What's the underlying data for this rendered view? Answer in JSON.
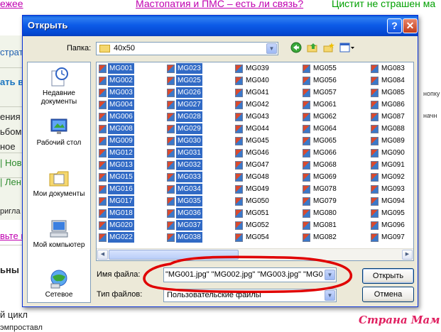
{
  "background_page": {
    "top_links": [
      "Мастопатия и ПМС – есть ли связь?",
      "Цистит не страшен ма"
    ],
    "left_texts": [
      "ежее",
      "страт",
      "ать в",
      "ения",
      "ьбом",
      "ное",
      "| Нов",
      "| Лен",
      "ригла",
      "вьте в",
      "ьны",
      "й цикл",
      "эмпроставл"
    ],
    "right_texts": [
      "нопку",
      "начн"
    ],
    "watermark": "Страна Мам"
  },
  "dialog": {
    "title": "Открыть",
    "help_button": "?",
    "close_button": "✕",
    "folder_label": "Папка:",
    "folder_value": "40x50",
    "toolbar_icons": [
      "back-icon",
      "up-folder-icon",
      "new-folder-icon",
      "view-menu-icon"
    ],
    "places": [
      {
        "label": "Недавние документы",
        "icon": "recent-documents-icon"
      },
      {
        "label": "Рабочий стол",
        "icon": "desktop-icon"
      },
      {
        "label": "Мои документы",
        "icon": "my-documents-icon"
      },
      {
        "label": "Мой компьютер",
        "icon": "my-computer-icon"
      },
      {
        "label": "Сетевое",
        "icon": "network-icon"
      }
    ],
    "file_columns": [
      {
        "selected": true,
        "files": [
          "MG001",
          "MG002",
          "MG003",
          "MG004",
          "MG006",
          "MG008",
          "MG009",
          "MG012",
          "MG013",
          "MG015",
          "MG016",
          "MG017",
          "MG018",
          "MG020",
          "MG022"
        ]
      },
      {
        "selected": true,
        "files": [
          "MG023",
          "MG025",
          "MG026",
          "MG027",
          "MG028",
          "MG029",
          "MG030",
          "MG031",
          "MG032",
          "MG033",
          "MG034",
          "MG035",
          "MG036",
          "MG037",
          "MG038"
        ]
      },
      {
        "selected": false,
        "files": [
          "MG039",
          "MG040",
          "MG041",
          "MG042",
          "MG043",
          "MG044",
          "MG045",
          "MG046",
          "MG047",
          "MG048",
          "MG049",
          "MG050",
          "MG051",
          "MG052",
          "MG054"
        ]
      },
      {
        "selected": false,
        "files": [
          "MG055",
          "MG056",
          "MG057",
          "MG061",
          "MG062",
          "MG064",
          "MG065",
          "MG066",
          "MG068",
          "MG069",
          "MG078",
          "MG079",
          "MG080",
          "MG081",
          "MG082"
        ]
      },
      {
        "selected": false,
        "files": [
          "MG083",
          "MG084",
          "MG085",
          "MG086",
          "MG087",
          "MG088",
          "MG089",
          "MG090",
          "MG091",
          "MG092",
          "MG093",
          "MG094",
          "MG095",
          "MG096",
          "MG097"
        ]
      }
    ],
    "filename_label": "Имя файла:",
    "filename_value": "\"MG001.jpg\" \"MG002.jpg\" \"MG003.jpg\" \"MG0",
    "filetype_label": "Тип файлов:",
    "filetype_value": "Пользовательские файлы",
    "open_button": "Открыть",
    "cancel_button": "Отмена"
  },
  "colors": {
    "selection": "#316ac5",
    "titlebar": "#0a5ad7",
    "annotation": "#e00000"
  }
}
